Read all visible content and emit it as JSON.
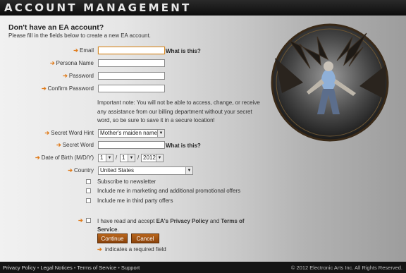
{
  "header": {
    "title": "ACCOUNT MANAGEMENT"
  },
  "intro": {
    "heading": "Don't have an EA account?",
    "subheading": "Please fill in the fields below to create a new EA account."
  },
  "form": {
    "email_label": "Email",
    "persona_label": "Persona Name",
    "password_label": "Password",
    "confirm_label": "Confirm Password",
    "what_is_this": "What is this?",
    "important_note": "Important note: You will not be able to access, change, or receive any assistance from our billing department without your secret word, so be sure to save it in a secure location!",
    "secret_hint_label": "Secret Word Hint",
    "secret_hint_value": "Mother's maiden name",
    "secret_word_label": "Secret Word",
    "dob_label": "Date of Birth (M/D/Y)",
    "dob_month": "1",
    "dob_day": "1",
    "dob_year": "2012",
    "dob_sep": "/",
    "country_label": "Country",
    "country_value": "United States",
    "newsletter": "Subscribe to newsletter",
    "marketing": "Include me in marketing and additional promotional offers",
    "third_party": "Include me in third party offers",
    "accept_prefix": "I have read and accept",
    "accept_privacy": "EA's Privacy Policy",
    "accept_and": "and",
    "accept_terms": "Terms of Service",
    "accept_suffix": ".",
    "continue_label": "Continue",
    "cancel_label": "Cancel",
    "required_note": "indicates a required field"
  },
  "footer": {
    "links": [
      "Privacy Policy",
      "Legal Notices",
      "Terms of Service",
      "Support"
    ],
    "sep": "•",
    "copyright": "© 2012 Electronic Arts Inc. All Rights Reserved."
  },
  "colors": {
    "accent_arrow": "#e07a18",
    "button": "#9a4d12",
    "header": "#111111"
  },
  "icons": {
    "required_marker": "arrow-right-icon",
    "artwork": "dragon-warrior-emblem"
  }
}
